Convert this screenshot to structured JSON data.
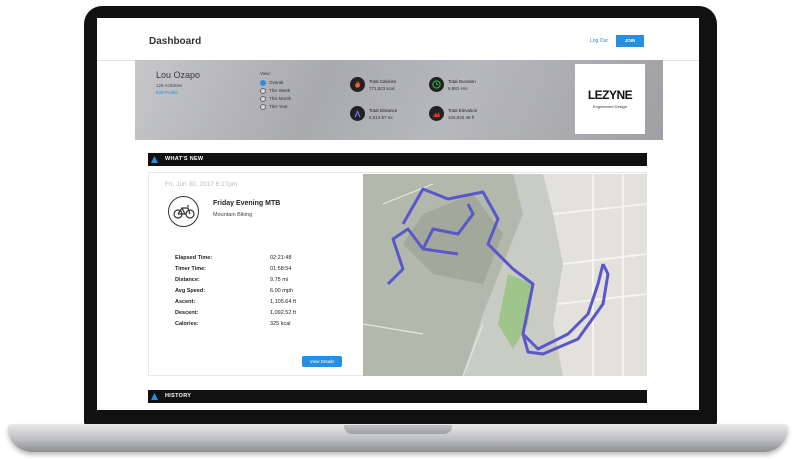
{
  "header": {
    "title": "Dashboard",
    "login_link": "Log Out",
    "join_button": "JOIN"
  },
  "profile": {
    "name": "Lou Ozapo",
    "subline": "128 Activities",
    "link": "Edit Profile",
    "view_label": "View:",
    "view_options": [
      {
        "label": "Overall",
        "selected": true
      },
      {
        "label": "This Week",
        "selected": false
      },
      {
        "label": "This Month",
        "selected": false
      },
      {
        "label": "This Year",
        "selected": false
      }
    ]
  },
  "stats": [
    {
      "icon": "flame-icon",
      "title": "Total Calories",
      "value": "771,823 kcal",
      "color": "#e8622a"
    },
    {
      "icon": "clock-icon",
      "title": "Total Duration",
      "value": "6,981 Hrs",
      "color": "#2faa4a"
    },
    {
      "icon": "distance-icon",
      "title": "Total Distance",
      "value": "6,513.87 mi",
      "color": "#4a56c9"
    },
    {
      "icon": "elevation-icon",
      "title": "Total Elevation",
      "value": "325,826.49 ft",
      "color": "#d9352b"
    }
  ],
  "brand": {
    "name": "LEZYNE",
    "tagline": "Engineered Design"
  },
  "sections": {
    "whats_new": "WHAT'S NEW",
    "history": "HISTORY"
  },
  "activity": {
    "date": "Fri, Jun 30, 2017 6:17pm",
    "name": "Friday Evening MTB",
    "type": "Mountain Biking",
    "metrics": [
      {
        "label": "Elapsed Time:",
        "value": "02:21:48"
      },
      {
        "label": "Timer Time:",
        "value": "01:58:54"
      },
      {
        "label": "Distance:",
        "value": "9.75 mi"
      },
      {
        "label": "Avg Speed:",
        "value": "6.00 mph"
      },
      {
        "label": "Ascent:",
        "value": "1,105.64 ft"
      },
      {
        "label": "Descent:",
        "value": "1,092.52 ft"
      },
      {
        "label": "Calories:",
        "value": "325 kcal"
      }
    ],
    "view_details": "View Details"
  },
  "colors": {
    "accent": "#2a8ee0",
    "route": "#5b57c8"
  }
}
